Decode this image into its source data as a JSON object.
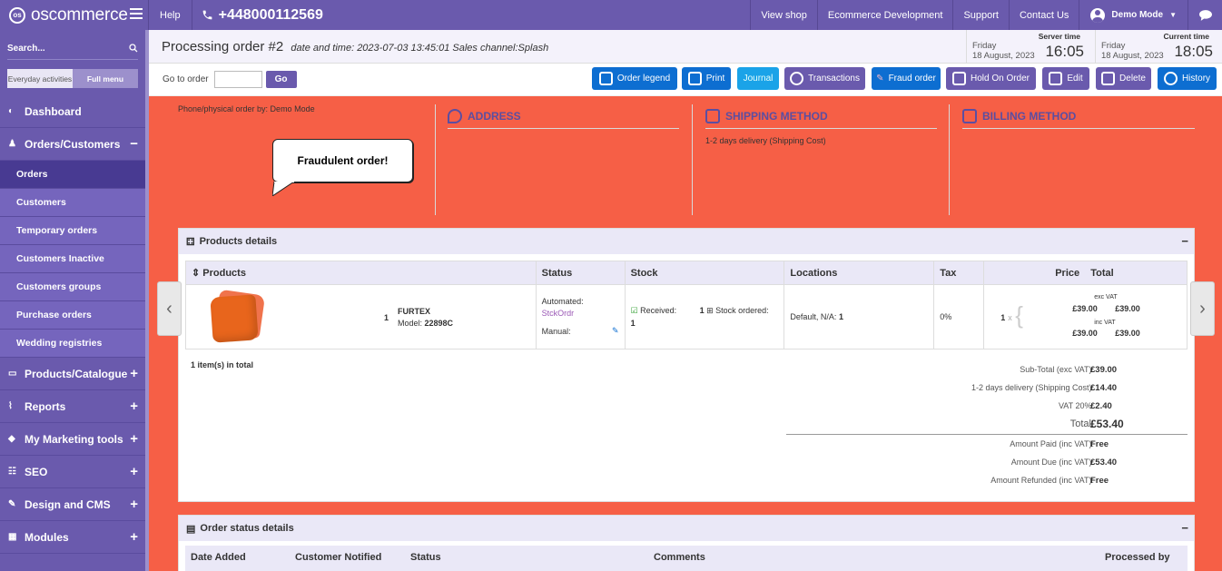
{
  "topbar": {
    "logo": "oscommerce",
    "logo_mark": "os",
    "help": "Help",
    "phone": "+448000112569",
    "links": [
      "View shop",
      "Ecommerce Development",
      "Support",
      "Contact Us"
    ],
    "user": "Demo Mode"
  },
  "sidebar": {
    "search_placeholder": "Search...",
    "tabs": [
      "Everyday activities",
      "Full menu"
    ],
    "dashboard": "Dashboard",
    "orders_customers": "Orders/Customers",
    "sub_items": [
      "Orders",
      "Customers",
      "Temporary orders",
      "Customers Inactive",
      "Customers groups",
      "Purchase orders",
      "Wedding registries"
    ],
    "sections": [
      "Products/Catalogue",
      "Reports",
      "My Marketing tools",
      "SEO",
      "Design and CMS",
      "Modules"
    ]
  },
  "header": {
    "title": "Processing order #2",
    "subtitle": "date and time: 2023-07-03 13:45:01  Sales channel:Splash",
    "server_time_label": "Server time",
    "server_day": "Friday",
    "server_date": "18 August, 2023",
    "server_time": "16:05",
    "current_time_label": "Current time",
    "current_day": "Friday",
    "current_date": "18 August, 2023",
    "current_time": "18:05"
  },
  "toolbar": {
    "goto_label": "Go to order",
    "go": "Go",
    "buttons": [
      "Order legend",
      "Print",
      "Journal",
      "Transactions",
      "Fraud order",
      "Hold On Order",
      "Edit",
      "Delete",
      "History"
    ]
  },
  "order_header": {
    "phone_order": "Phone/physical order by: Demo Mode",
    "fraud_bubble": "Fraudulent order!",
    "address": "ADDRESS",
    "shipping_method": "SHIPPING METHOD",
    "shipping_text": "1-2 days delivery  (Shipping Cost)",
    "billing_method": "BILLING METHOD"
  },
  "products": {
    "panel_title": "Products details",
    "headers": [
      "Products",
      "Status",
      "Stock",
      "Locations",
      "Tax",
      "Price",
      "Total"
    ],
    "qty": "1",
    "name": "FURTEX",
    "model_label": "Model:",
    "model": "22898C",
    "status_automated": "Automated:",
    "status_link": "StckOrdr",
    "status_manual": "Manual:",
    "received_label": "Received:",
    "received_qty": "1",
    "stock_ordered_qty": "1",
    "stock_ordered_label": "Stock ordered:",
    "location": "Default, N/A:",
    "location_qty": "1",
    "tax": "0%",
    "price_qty": "1",
    "price_x": "x",
    "exc_vat": "exc VAT",
    "exc_price": "£39.00",
    "exc_total": "£39.00",
    "inc_vat": "inc VAT",
    "inc_price": "£39.00",
    "inc_total": "£39.00",
    "items_total": "1 item(s) in total"
  },
  "totals": [
    {
      "label": "Sub-Total (exc VAT):",
      "value": "£39.00"
    },
    {
      "label": "1-2 days delivery  (Shipping Cost):",
      "value": "£14.40"
    },
    {
      "label": "VAT 20%:",
      "value": "£2.40"
    },
    {
      "label": "Total:",
      "value": "£53.40"
    },
    {
      "label": "Amount Paid (inc VAT):",
      "value": "Free"
    },
    {
      "label": "Amount Due (inc VAT):",
      "value": "£53.40"
    },
    {
      "label": "Amount Refunded (inc VAT):",
      "value": "Free"
    }
  ],
  "status_panel": {
    "title": "Order status details",
    "headers": [
      "Date Added",
      "Customer Notified",
      "Status",
      "Comments",
      "Processed by"
    ]
  }
}
